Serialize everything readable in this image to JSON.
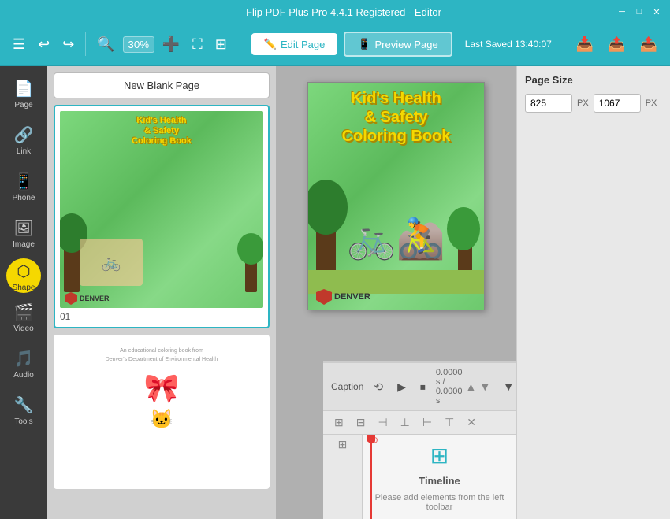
{
  "titlebar": {
    "title": "Flip PDF Plus Pro 4.4.1 Registered - Editor",
    "min_btn": "─",
    "max_btn": "□",
    "close_btn": "✕"
  },
  "toolbar": {
    "zoom_value": "30%",
    "edit_page_label": "Edit Page",
    "preview_page_label": "Preview Page",
    "last_saved": "Last Saved 13:40:07"
  },
  "sidebar": {
    "items": [
      {
        "id": "page",
        "label": "Page",
        "icon": "📄"
      },
      {
        "id": "link",
        "label": "Link",
        "icon": "🔗"
      },
      {
        "id": "phone",
        "label": "Phone",
        "icon": "📱"
      },
      {
        "id": "image",
        "label": "Image",
        "icon": "🖼"
      },
      {
        "id": "shape",
        "label": "Shape",
        "icon": "⬡"
      },
      {
        "id": "video",
        "label": "Video",
        "icon": "🎬"
      },
      {
        "id": "audio",
        "label": "Audio",
        "icon": "🎵"
      },
      {
        "id": "tools",
        "label": "Tools",
        "icon": "🔧"
      }
    ]
  },
  "thumb_panel": {
    "new_blank_label": "New Blank Page",
    "pages": [
      {
        "id": "01",
        "label": "01",
        "selected": true
      },
      {
        "id": "02",
        "label": "",
        "selected": false
      }
    ]
  },
  "right_panel": {
    "title": "Page Size",
    "width_value": "825",
    "height_value": "1067",
    "unit": "PX"
  },
  "caption_bar": {
    "label": "Caption",
    "time_display": "0.0000 s / 0.0000 s"
  },
  "timeline": {
    "icon": "⊞",
    "title": "Timeline",
    "subtitle": "Please add elements from the left toolbar"
  }
}
